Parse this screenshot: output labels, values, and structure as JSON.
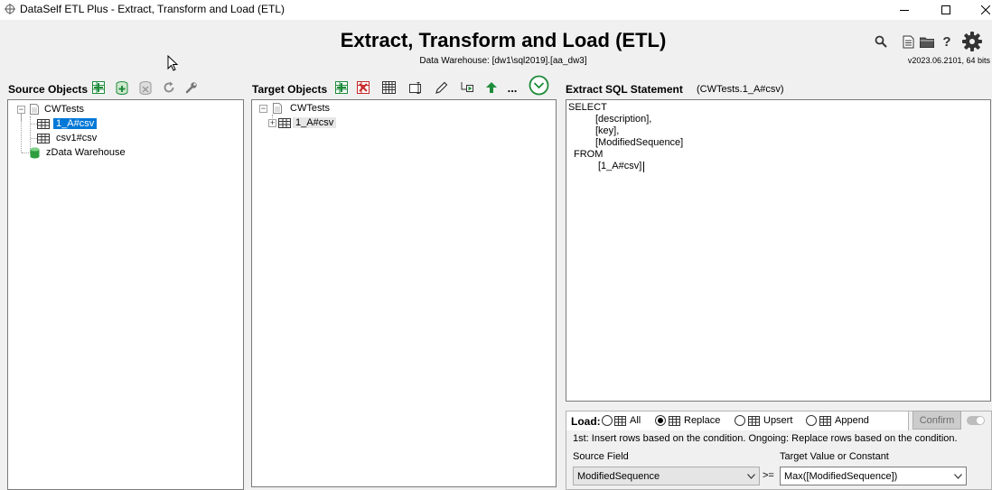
{
  "window": {
    "title": "DataSelf ETL Plus - Extract, Transform and Load (ETL)"
  },
  "header": {
    "title": "Extract, Transform and Load (ETL)",
    "subtitle": "Data Warehouse: [dw1\\sql2019].[aa_dw3]",
    "version": "v2023.06.2101, 64 bits"
  },
  "source_panel": {
    "label": "Source Objects",
    "tree": {
      "root": "CWTests",
      "items": [
        "1_A#csv",
        "csv1#csv"
      ],
      "warehouse": "zData Warehouse"
    }
  },
  "target_panel": {
    "label": "Target Objects",
    "more": "...",
    "tree": {
      "root": "CWTests",
      "items": [
        "1_A#csv"
      ]
    }
  },
  "sql_panel": {
    "label": "Extract SQL Statement",
    "context": "(CWTests.1_A#csv)",
    "lines": [
      "SELECT",
      "[description],",
      "[key],",
      "[ModifiedSequence]",
      "FROM",
      "[1_A#csv]"
    ]
  },
  "load": {
    "label": "Load:",
    "options": [
      "All",
      "Replace",
      "Upsert",
      "Append"
    ],
    "selected": "Replace",
    "confirm_label": "Confirm",
    "description": "1st: Insert rows based on the condition. Ongoing: Replace rows based on the condition.",
    "source_field_label": "Source Field",
    "source_field_value": "ModifiedSequence",
    "operator": ">=",
    "target_value_label": "Target Value or Constant",
    "target_value": "Max([ModifiedSequence])"
  },
  "colors": {
    "selection": "#0078d7",
    "toolbar_green": "#1e8c3a",
    "toolbar_red": "#c62828"
  }
}
